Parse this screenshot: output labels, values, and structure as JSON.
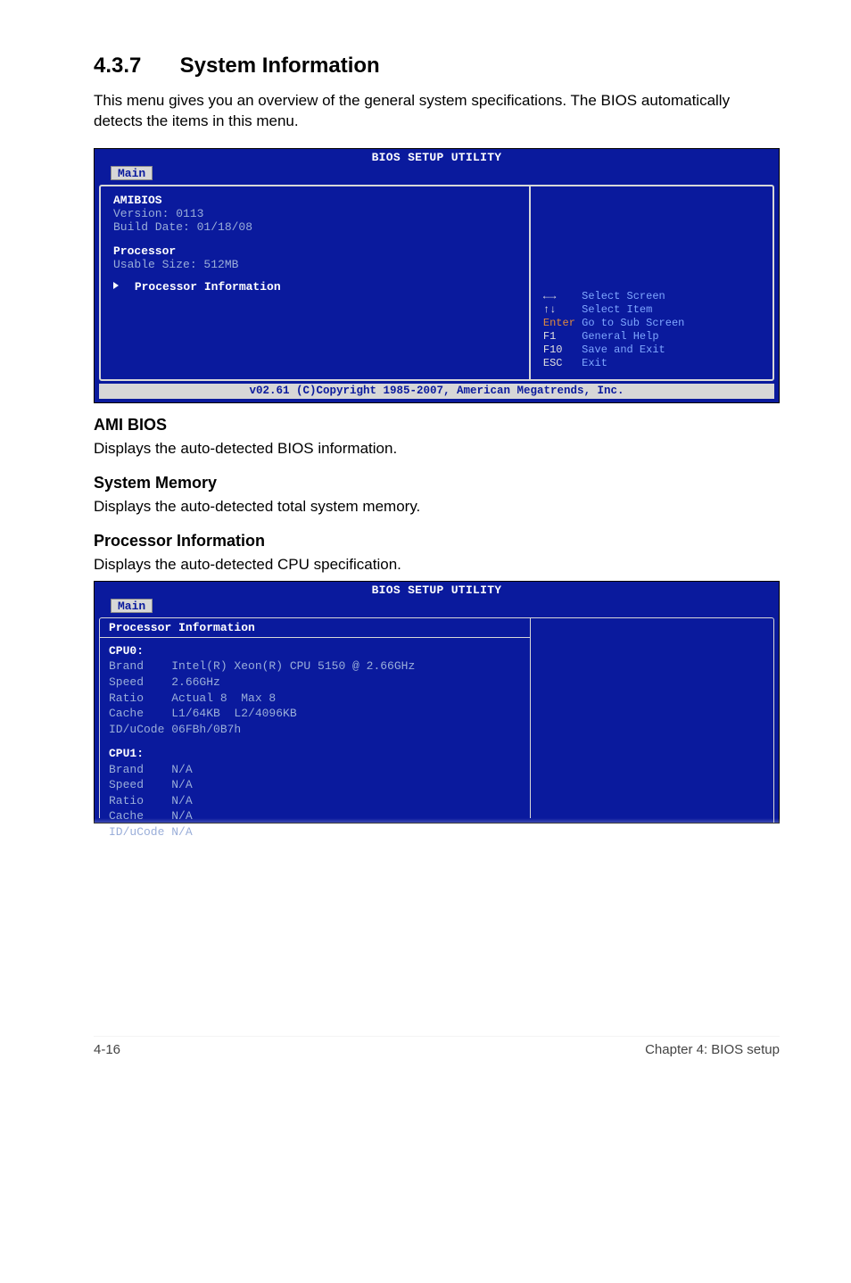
{
  "section": {
    "number": "4.3.7",
    "title": "System Information",
    "intro": "This menu gives you an overview of the general system specifications. The BIOS automatically detects the items in this menu."
  },
  "bios1": {
    "header": "BIOS SETUP UTILITY",
    "tab": "Main",
    "left": {
      "h1": "AMIBIOS",
      "l1": "Version:     0113",
      "l2": "Build Date: 01/18/08",
      "h2": "Processor",
      "l3": "Usable Size: 512MB",
      "submenu": "Processor Information"
    },
    "hints": {
      "r0k": "←→",
      "r0t": "Select Screen",
      "r1k": "↑↓",
      "r1t": "Select Item",
      "r2k": "Enter",
      "r2t": "Go to Sub Screen",
      "r3k": "F1",
      "r3t": "General Help",
      "r4k": "F10",
      "r4t": "Save and Exit",
      "r5k": "ESC",
      "r5t": "Exit"
    },
    "footer": "v02.61 (C)Copyright 1985-2007, American Megatrends, Inc."
  },
  "sections": {
    "ami_h": "AMI BIOS",
    "ami_p": "Displays the auto-detected BIOS information.",
    "mem_h": "System Memory",
    "mem_p": "Displays the auto-detected total system memory.",
    "proc_h": "Processor Information",
    "proc_p": "Displays the auto-detected CPU specification."
  },
  "bios2": {
    "header": "BIOS SETUP UTILITY",
    "tab": "Main",
    "title": "Processor Information",
    "cpu0": {
      "h": "CPU0:",
      "brand": "Brand    Intel(R) Xeon(R) CPU 5150 @ 2.66GHz",
      "speed": "Speed    2.66GHz",
      "ratio": "Ratio    Actual 8  Max 8",
      "cache": "Cache    L1/64KB  L2/4096KB",
      "ucode": "ID/uCode 06FBh/0B7h"
    },
    "cpu1": {
      "h": "CPU1:",
      "brand": "Brand    N/A",
      "speed": "Speed    N/A",
      "ratio": "Ratio    N/A",
      "cache": "Cache    N/A",
      "ucode": "ID/uCode N/A"
    }
  },
  "footer": {
    "left": "4-16",
    "right": "Chapter 4: BIOS setup"
  }
}
